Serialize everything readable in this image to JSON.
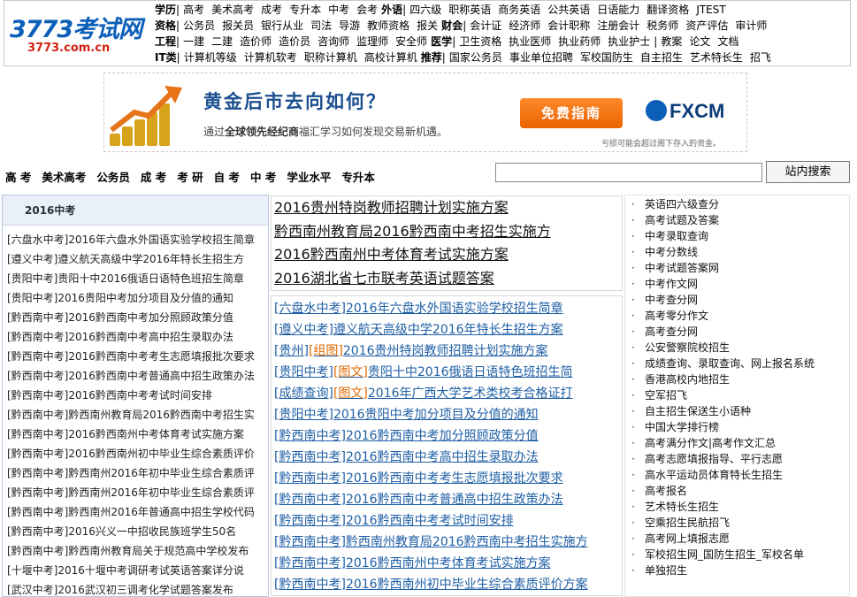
{
  "logo": {
    "main": "3773考试网",
    "domain": "3773.com.cn"
  },
  "nav_rows": [
    {
      "category": "学历",
      "items": [
        "高考",
        "美术高考",
        "成考",
        "专升本",
        "中考",
        "会考"
      ],
      "category2": "外语",
      "items2": [
        "四六级",
        "职称英语",
        "商务英语",
        "公共英语",
        "日语能力",
        "翻译资格",
        "JTEST"
      ]
    },
    {
      "category": "资格",
      "items": [
        "公务员",
        "报关员",
        "银行从业",
        "司法",
        "导游",
        "教师资格",
        "报关"
      ],
      "category2": "财会",
      "items2": [
        "会计证",
        "经济师",
        "会计职称",
        "注册会计",
        "税务师",
        "资产评估",
        "审计师"
      ]
    },
    {
      "category": "工程",
      "items": [
        "一建",
        "二建",
        "造价师",
        "造价员",
        "咨询师",
        "监理师",
        "安全师"
      ],
      "category2": "医学",
      "items2": [
        "卫生资格",
        "执业医师",
        "执业药师",
        "执业护士"
      ],
      "extra": [
        "教案",
        "论文",
        "文档"
      ]
    },
    {
      "category": "IT类",
      "items": [
        "计算机等级",
        "计算机软考",
        "职称计算机",
        "高校计算机"
      ],
      "category2": "推荐",
      "items2": [
        "国家公务员",
        "事业单位招聘",
        "军校国防生",
        "自主招生",
        "艺术特长生",
        "招飞"
      ]
    }
  ],
  "ad": {
    "headline": "黄金后市去向如何？",
    "sub_prefix": "通过",
    "sub_bold": "全球领先经纪商",
    "sub_suffix": "福汇学习如何发现交易新机遇。",
    "button": "免费指南",
    "brand": "FXCM",
    "warning": "亏损可能会超过阁下存入的资金。"
  },
  "subnav": [
    "高 考",
    "美术高考",
    "公务员",
    "成 考",
    "考 研",
    "自 考",
    "中 考",
    "学业水平",
    "专升本"
  ],
  "search": {
    "value": "",
    "button": "站内搜索"
  },
  "left": {
    "title": "2016中考",
    "items": [
      "[六盘水中考]2016年六盘水外国语实验学校招生简章",
      "[遵义中考]遵义航天高级中学2016年特长生招生方",
      "[贵阳中考]贵阳十中2016俄语日语特色班招生简章",
      "[贵阳中考]2016贵阳中考加分项目及分值的通知",
      "[黔西南中考]2016黔西南中考加分照顾政策分值",
      "[黔西南中考]2016黔西南中考高中招生录取办法",
      "[黔西南中考]2016黔西南中考考生志愿填报批次要求",
      "[黔西南中考]2016黔西南中考普通高中招生政策办法",
      "[黔西南中考]2016黔西南中考考试时间安排",
      "[黔西南中考]黔西南州教育局2016黔西南中考招生实",
      "[黔西南中考]2016黔西南州中考体育考试实施方案",
      "[黔西南中考]2016黔西南州初中毕业生综合素质评价",
      "[黔西南中考]黔西南州2016年初中毕业生综合素质评",
      "[黔西南中考]黔西南州2016年初中毕业生综合素质评",
      "[黔西南中考]黔西南州2016年普通高中招生学校代码",
      "[黔西南中考]2016兴义一中招收民族班学生50名",
      "[黔西南中考]黔西南州教育局关于规范高中学校发布",
      "[十堰中考]2016十堰中考调研考试英语答案详分说",
      "[武汉中考]2016武汉初三调考化学试题答案发布"
    ]
  },
  "middle": {
    "headlines": [
      "2016贵州特岗教师招聘计划实施方案",
      "黔西南州教育局2016黔西南中考招生实施方",
      "2016黔西南州中考体育考试实施方案",
      "2016湖北省七市联考英语试题答案"
    ],
    "items": [
      {
        "tag": "[六盘水中考]",
        "tag2": "",
        "text": "2016年六盘水外国语实验学校招生简章"
      },
      {
        "tag": "[遵义中考]",
        "tag2": "",
        "text": "遵义航天高级中学2016年特长生招生方案"
      },
      {
        "tag": "[贵州]",
        "tag2": "[组图]",
        "text": "2016贵州特岗教师招聘计划实施方案"
      },
      {
        "tag": "[贵阳中考]",
        "tag2": "[图文]",
        "text": "贵阳十中2016俄语日语特色班招生简"
      },
      {
        "tag": "[成绩查询]",
        "tag2": "[图文]",
        "text": "2016年广西大学艺术类校考合格证打"
      },
      {
        "tag": "[贵阳中考]",
        "tag2": "",
        "text": "2016贵阳中考加分项目及分值的通知"
      },
      {
        "tag": "[黔西南中考]",
        "tag2": "",
        "text": "2016黔西南中考加分照顾政策分值"
      },
      {
        "tag": "[黔西南中考]",
        "tag2": "",
        "text": "2016黔西南中考高中招生录取办法"
      },
      {
        "tag": "[黔西南中考]",
        "tag2": "",
        "text": "2016黔西南中考考生志愿填报批次要求"
      },
      {
        "tag": "[黔西南中考]",
        "tag2": "",
        "text": "2016黔西南中考普通高中招生政策办法"
      },
      {
        "tag": "[黔西南中考]",
        "tag2": "",
        "text": "2016黔西南中考考试时间安排"
      },
      {
        "tag": "[黔西南中考]",
        "tag2": "",
        "text": "黔西南州教育局2016黔西南中考招生实施方"
      },
      {
        "tag": "[黔西南中考]",
        "tag2": "",
        "text": "2016黔西南州中考体育考试实施方案"
      },
      {
        "tag": "[黔西南中考]",
        "tag2": "",
        "text": "2016黔西南州初中毕业生综合素质评价方案"
      },
      {
        "tag": "[黔西南中考]",
        "tag2": "",
        "text": "黔西南州2016年初中毕业生综合素质评价"
      }
    ]
  },
  "right": {
    "items": [
      "英语四六级查分",
      "高考试题及答案",
      "中考录取查询",
      "中考分数线",
      "中考试题答案网",
      "中考作文网",
      "中考查分网",
      "高考零分作文",
      "高考查分网",
      "公安警察院校招生",
      "成绩查询、录取查询、网上报名系统",
      "香港高校内地招生",
      "空军招飞",
      "自主招生保送生小语种",
      "中国大学排行榜",
      "高考满分作文|高考作文汇总",
      "高考志愿填报指导、平行志愿",
      "高水平运动员体育特长生招生",
      "高考报名",
      "艺术特长生招生",
      "空乘招生民航招飞",
      "高考网上填报志愿",
      "军校招生网_国防生招生_军校名单",
      "单独招生"
    ]
  },
  "colors": {
    "link_blue": "#1f5fa5",
    "logo_blue": "#0b5fb8",
    "logo_red": "#d2220f",
    "orange": "#e06a00",
    "ad_button": "#f07a12"
  }
}
